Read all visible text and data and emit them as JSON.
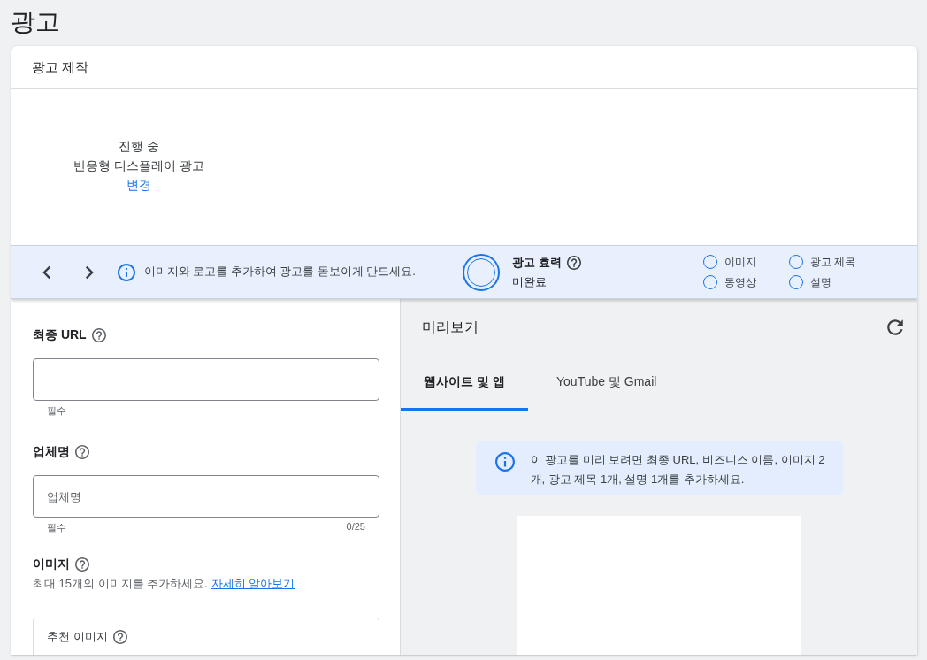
{
  "page_title": "광고",
  "card_title": "광고 제작",
  "ad_type": {
    "status": "진행 중",
    "name": "반응형 디스플레이 광고",
    "change_link": "변경"
  },
  "toolbar": {
    "tip": "이미지와 로고를 추가하여 광고를 돋보이게 만드세요.",
    "strength_label": "광고 효력",
    "strength_value": "미완료",
    "checklist": [
      {
        "label": "이미지",
        "checked": false
      },
      {
        "label": "광고 제목",
        "checked": false
      },
      {
        "label": "동영상",
        "checked": false
      },
      {
        "label": "설명",
        "checked": false
      }
    ]
  },
  "form": {
    "final_url": {
      "label": "최종 URL",
      "helper": "필수"
    },
    "business_name": {
      "label": "업체명",
      "placeholder": "업체명",
      "helper": "필수",
      "counter": "0/25"
    },
    "images": {
      "label": "이미지",
      "description": "최대 15개의 이미지를 추가하세요.",
      "link": "자세히 알아보기",
      "recommended_label": "추천 이미지"
    }
  },
  "preview": {
    "title": "미리보기",
    "tabs": [
      {
        "label": "웹사이트 및 앱",
        "selected": true
      },
      {
        "label": "YouTube 및 Gmail",
        "selected": false
      }
    ],
    "notice": "이 광고를 미리 보려면 최종 URL, 비즈니스 이름, 이미지 2개, 광고 제목 1개, 설명 1개를 추가하세요."
  }
}
